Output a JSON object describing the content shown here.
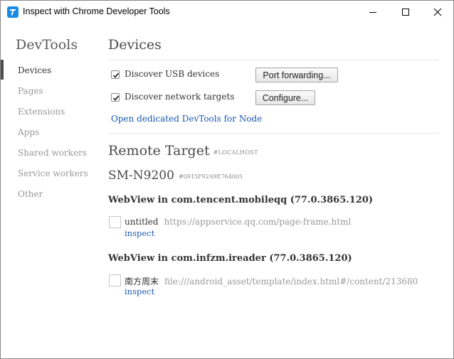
{
  "window": {
    "title": "Inspect with Chrome Developer Tools"
  },
  "icons": {
    "app": "chrome-devtools-icon",
    "minimize": "minimize-icon",
    "maximize": "maximize-icon",
    "close": "close-icon",
    "check": "checkmark-icon"
  },
  "colors": {
    "link": "#1a57b0",
    "app_icon": "#1a8be6",
    "nav_inactive": "#999999",
    "nav_active": "#333333"
  },
  "sidebar": {
    "title": "DevTools",
    "items": [
      {
        "label": "Devices",
        "active": true
      },
      {
        "label": "Pages",
        "active": false
      },
      {
        "label": "Extensions",
        "active": false
      },
      {
        "label": "Apps",
        "active": false
      },
      {
        "label": "Shared workers",
        "active": false
      },
      {
        "label": "Service workers",
        "active": false
      },
      {
        "label": "Other",
        "active": false
      }
    ]
  },
  "devices": {
    "title": "Devices",
    "discover_usb": {
      "label": "Discover USB devices",
      "checked": true
    },
    "discover_network": {
      "label": "Discover network targets",
      "checked": true
    },
    "port_forwarding_label": "Port forwarding...",
    "configure_label": "Configure...",
    "node_link": "Open dedicated DevTools for Node"
  },
  "remote": {
    "title": "Remote Target",
    "tag": "#LOCALHOST",
    "device_name": "SM-N9200",
    "device_serial": "#0915F92A9E764005",
    "webviews": [
      {
        "title": "WebView in com.tencent.mobileqq (77.0.3865.120)",
        "target": {
          "name": "untitled",
          "url": "https://appservice.qq.com/page-frame.html",
          "inspect_label": "inspect"
        }
      },
      {
        "title": "WebView in com.infzm.ireader (77.0.3865.120)",
        "target": {
          "name": "南方周末",
          "url": "file:///android_asset/template/index.html#/content/213680",
          "inspect_label": "inspect"
        }
      }
    ]
  }
}
